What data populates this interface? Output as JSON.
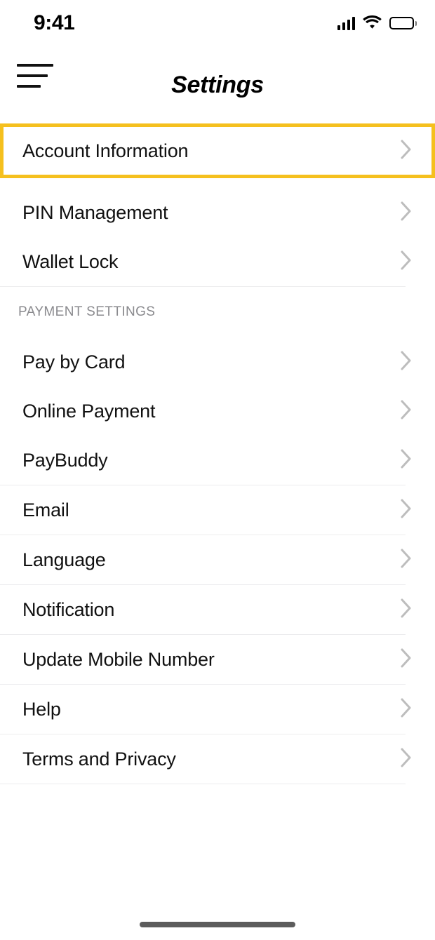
{
  "status_bar": {
    "time": "9:41",
    "signal_icon": "cellular-signal-icon",
    "wifi_icon": "wifi-icon",
    "battery_icon": "battery-full-icon"
  },
  "nav": {
    "menu_icon": "hamburger-menu-icon",
    "title": "Settings"
  },
  "colors": {
    "highlight": "#F5C01E",
    "divider": "#ECECEE",
    "label": "#111111",
    "section_header": "#8A8A8E",
    "chevron": "#BDBDBD",
    "home_indicator": "#5C5C5C"
  },
  "list": {
    "account_section": [
      {
        "label": "Account Information",
        "accessory": "chevron-right-icon",
        "highlighted": true
      },
      {
        "label": "PIN Management",
        "accessory": "chevron-right-icon",
        "highlighted": false
      },
      {
        "label": "Wallet Lock",
        "accessory": "chevron-right-icon",
        "highlighted": false
      }
    ],
    "payment_section_header": "PAYMENT SETTINGS",
    "payment_section": [
      {
        "label": "Pay by Card",
        "accessory": "chevron-right-icon"
      },
      {
        "label": "Online Payment",
        "accessory": "chevron-right-icon"
      },
      {
        "label": "PayBuddy",
        "accessory": "chevron-right-icon"
      }
    ],
    "general_section": [
      {
        "label": "Email",
        "accessory": "chevron-right-icon"
      },
      {
        "label": "Language",
        "accessory": "chevron-right-icon"
      },
      {
        "label": "Notification",
        "accessory": "chevron-right-icon"
      },
      {
        "label": "Update Mobile Number",
        "accessory": "chevron-right-icon"
      },
      {
        "label": "Help",
        "accessory": "chevron-right-icon"
      },
      {
        "label": "Terms and Privacy",
        "accessory": "chevron-right-icon"
      }
    ]
  },
  "home_indicator": "home-indicator-bar"
}
